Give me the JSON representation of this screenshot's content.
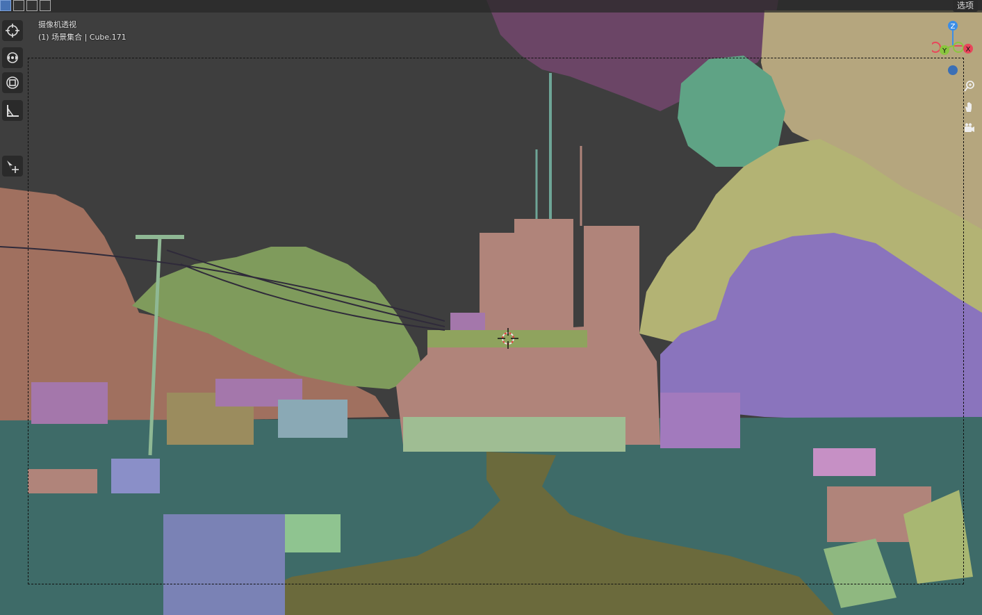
{
  "header": {
    "view_name": "摄像机透视",
    "collection_info": "(1) 场景集合 | Cube.171",
    "options_label": "选项"
  },
  "select_modes": [
    {
      "icon": "select-new-icon",
      "active": true
    },
    {
      "icon": "select-extend-icon",
      "active": false
    },
    {
      "icon": "select-subtract-icon",
      "active": false
    },
    {
      "icon": "select-intersect-icon",
      "active": false
    }
  ],
  "toolbar": {
    "tools": [
      {
        "icon": "cursor-icon"
      },
      {
        "icon": "orbit-move-icon"
      },
      {
        "icon": "scale-icon"
      },
      {
        "icon": "measure-icon"
      },
      {
        "icon": "add-object-icon"
      }
    ]
  },
  "gizmo": {
    "axes": [
      "Z",
      "Y",
      "X"
    ],
    "axis_colors": {
      "x": "#e8465a",
      "y": "#8bc63f",
      "z": "#3b8ee8"
    }
  },
  "nav_buttons": [
    {
      "icon": "zoom-icon"
    },
    {
      "icon": "pan-hand-icon"
    },
    {
      "icon": "camera-view-icon"
    }
  ],
  "colors": {
    "sky": "#3f3f3f",
    "ground": "#3e6b68",
    "path": "#6b6a3c",
    "building": "#b0847a",
    "rock_brown": "#a0705f",
    "rock_green": "#7f9b5c",
    "rock_teal": "#5fa385",
    "rock_khaki": "#b5a67e",
    "rock_olive": "#b3b374",
    "rock_purple": "#8a74bd",
    "rock_plum": "#6b4566"
  }
}
